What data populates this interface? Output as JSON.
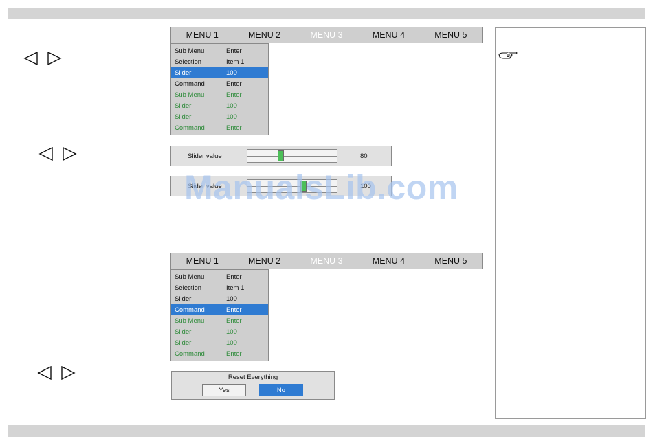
{
  "watermark": "ManualsLib.com",
  "menu": {
    "tabs": [
      "MENU 1",
      "MENU 2",
      "MENU 3",
      "MENU 4",
      "MENU 5"
    ],
    "active_index": 2
  },
  "dropdown_a": {
    "items": [
      {
        "label": "Sub Menu",
        "value": "Enter"
      },
      {
        "label": "Selection",
        "value": "Item 1"
      },
      {
        "label": "Slider",
        "value": "100"
      },
      {
        "label": "Command",
        "value": "Enter"
      },
      {
        "label": "Sub Menu",
        "value": "Enter"
      },
      {
        "label": "Slider",
        "value": "100"
      },
      {
        "label": "Slider",
        "value": "100"
      },
      {
        "label": "Command",
        "value": "Enter"
      }
    ],
    "selected_index": 2
  },
  "dropdown_b": {
    "items": [
      {
        "label": "Sub Menu",
        "value": "Enter"
      },
      {
        "label": "Selection",
        "value": "Item 1"
      },
      {
        "label": "Slider",
        "value": "100"
      },
      {
        "label": "Command",
        "value": "Enter"
      },
      {
        "label": "Sub Menu",
        "value": "Enter"
      },
      {
        "label": "Slider",
        "value": "100"
      },
      {
        "label": "Slider",
        "value": "100"
      },
      {
        "label": "Command",
        "value": "Enter"
      }
    ],
    "selected_index": 3
  },
  "slider_1": {
    "label": "Slider value",
    "value": "80",
    "level": 0.36
  },
  "slider_2": {
    "label": "Slider value",
    "value": "100",
    "level": 0.64
  },
  "dialog": {
    "title": "Reset Everything",
    "yes_label": "Yes",
    "no_label": "No"
  },
  "colors": {
    "highlight": "#2f7bd2",
    "secondary_text": "#2e8b3a",
    "thumb": "#4cbf58"
  },
  "icons": {
    "left": "left-arrow-icon",
    "right": "right-arrow-icon",
    "note": "pointing-hand-icon"
  }
}
